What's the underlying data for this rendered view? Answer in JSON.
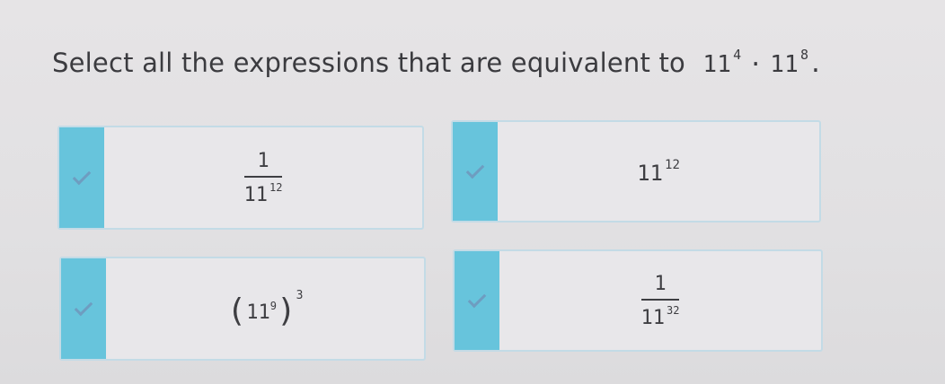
{
  "question": {
    "prompt": "Select all the expressions that are equivalent to",
    "base_a": "11",
    "exp_a": "4",
    "operator": "·",
    "base_b": "11",
    "exp_b": "8",
    "end": "."
  },
  "options": [
    {
      "numerator": "1",
      "base": "11",
      "exponent": "12",
      "selected": true
    },
    {
      "base": "11",
      "exponent": "12",
      "selected": true
    },
    {
      "open_paren": "(",
      "base": "11",
      "inner_exponent": "9",
      "close_paren": ")",
      "outer_exponent": "3",
      "selected": true
    },
    {
      "numerator": "1",
      "base": "11",
      "exponent": "32",
      "selected": true
    }
  ],
  "colors": {
    "check_panel": "#67c4dc",
    "check_mark": "#6e9dc0",
    "card_border": "#c3dbe6",
    "card_background": "#e8e7ea"
  },
  "icons": {
    "selection_mark": "checkmark-icon"
  }
}
